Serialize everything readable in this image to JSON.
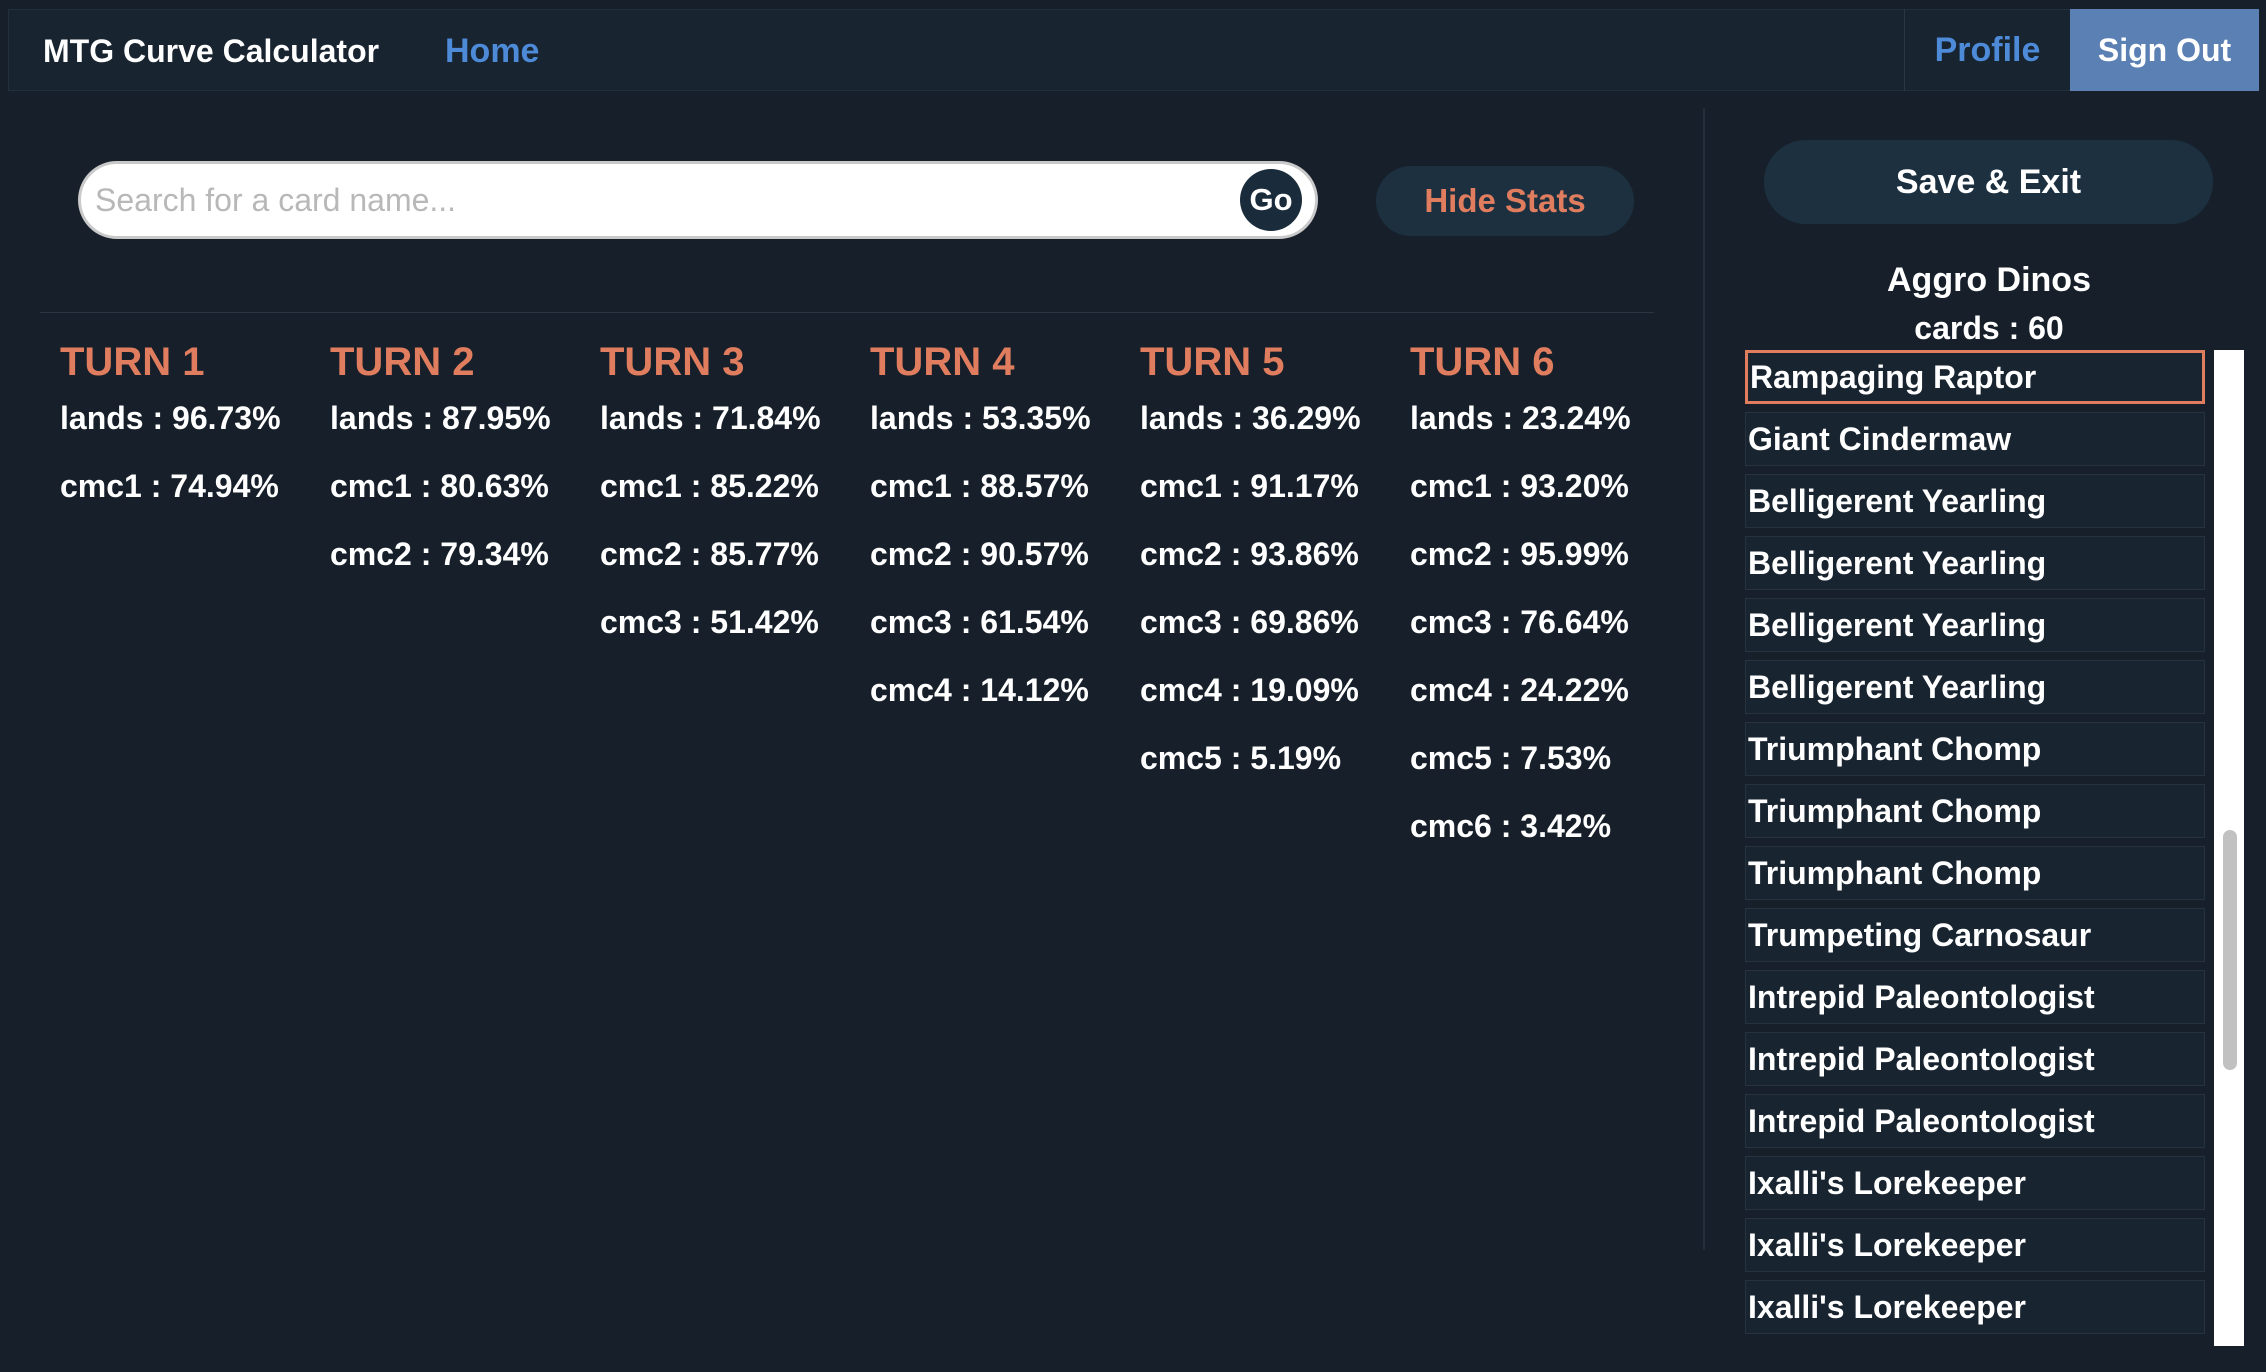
{
  "navbar": {
    "brand": "MTG Curve Calculator",
    "home": "Home",
    "profile": "Profile",
    "sign_out": "Sign Out"
  },
  "search": {
    "placeholder": "Search for a card name...",
    "value": "",
    "go_label": "Go"
  },
  "hide_stats_label": "Hide Stats",
  "turns": [
    {
      "title": "TURN 1",
      "stats": [
        "lands : 96.73%",
        "cmc1 : 74.94%"
      ]
    },
    {
      "title": "TURN 2",
      "stats": [
        "lands : 87.95%",
        "cmc1 : 80.63%",
        "cmc2 : 79.34%"
      ]
    },
    {
      "title": "TURN 3",
      "stats": [
        "lands : 71.84%",
        "cmc1 : 85.22%",
        "cmc2 : 85.77%",
        "cmc3 : 51.42%"
      ]
    },
    {
      "title": "TURN 4",
      "stats": [
        "lands : 53.35%",
        "cmc1 : 88.57%",
        "cmc2 : 90.57%",
        "cmc3 : 61.54%",
        "cmc4 : 14.12%"
      ]
    },
    {
      "title": "TURN 5",
      "stats": [
        "lands : 36.29%",
        "cmc1 : 91.17%",
        "cmc2 : 93.86%",
        "cmc3 : 69.86%",
        "cmc4 : 19.09%",
        "cmc5 : 5.19%"
      ]
    },
    {
      "title": "TURN 6",
      "stats": [
        "lands : 23.24%",
        "cmc1 : 93.20%",
        "cmc2 : 95.99%",
        "cmc3 : 76.64%",
        "cmc4 : 24.22%",
        "cmc5 : 7.53%",
        "cmc6 : 3.42%"
      ]
    }
  ],
  "sidebar": {
    "save_exit": "Save & Exit",
    "deck_name": "Aggro Dinos",
    "card_count": "cards : 60",
    "cards": [
      "Rampaging Raptor",
      "Giant Cindermaw",
      "Belligerent Yearling",
      "Belligerent Yearling",
      "Belligerent Yearling",
      "Belligerent Yearling",
      "Triumphant Chomp",
      "Triumphant Chomp",
      "Triumphant Chomp",
      "Trumpeting Carnosaur",
      "Intrepid Paleontologist",
      "Intrepid Paleontologist",
      "Intrepid Paleontologist",
      "Ixalli's Lorekeeper",
      "Ixalli's Lorekeeper",
      "Ixalli's Lorekeeper"
    ]
  },
  "colors": {
    "background": "#17202a",
    "accent_orange": "#e07d5f",
    "link_blue": "#4d8ad8",
    "sign_out_bg": "#5b80b4"
  }
}
